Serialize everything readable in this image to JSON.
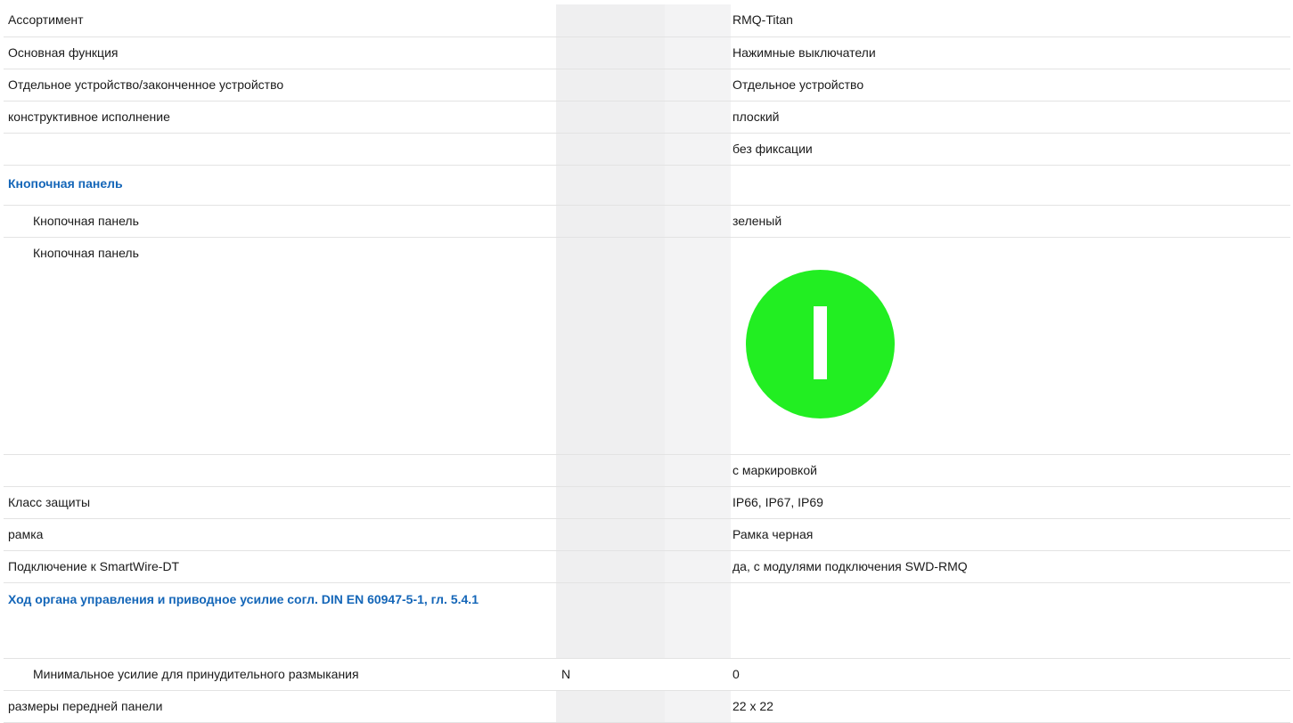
{
  "rows": [
    {
      "label": "Ассортимент",
      "unit": "",
      "value": "RMQ-Titan"
    },
    {
      "label": "Основная функция",
      "unit": "",
      "value": "Нажимные выключатели"
    },
    {
      "label": "Отдельное устройство/законченное устройство",
      "unit": "",
      "value": "Отдельное устройство"
    },
    {
      "label": "конструктивное исполнение",
      "unit": "",
      "value": "плоский"
    },
    {
      "label": "",
      "unit": "",
      "value": "без фиксации"
    }
  ],
  "section_button_panel": {
    "heading": "Кнопочная панель",
    "color_row": {
      "label": "Кнопочная панель",
      "value": "зеленый"
    },
    "image_row": {
      "label": "Кнопочная панель",
      "image_icon": "green-push-button-marked-I-icon",
      "button_color": "#22ee22",
      "marking_color": "#ffffff"
    }
  },
  "rows2": [
    {
      "label": "",
      "unit": "",
      "value": "с маркировкой"
    },
    {
      "label": "Класс защиты",
      "unit": "",
      "value": "IP66, IP67, IP69"
    },
    {
      "label": "рамка",
      "unit": "",
      "value": "Рамка черная"
    },
    {
      "label": "Подключение к SmartWire-DT",
      "unit": "",
      "value": "да, с модулями подключения SWD-RMQ"
    }
  ],
  "section_actuation": {
    "heading": "Ход органа управления и приводное усилие согл. DIN EN 60947-5-1, гл. 5.4.1",
    "row": {
      "label": "Минимальное усилие для принудительного размыкания",
      "unit": "N",
      "value": "0"
    }
  },
  "rows3": [
    {
      "label": "размеры передней панели",
      "unit": "",
      "value": "22 x 22"
    }
  ],
  "colors": {
    "heading": "#1466b8",
    "shade_unit": "#efeff0",
    "shade_gap": "#f3f3f4",
    "row_border": "#e3e3e3"
  }
}
